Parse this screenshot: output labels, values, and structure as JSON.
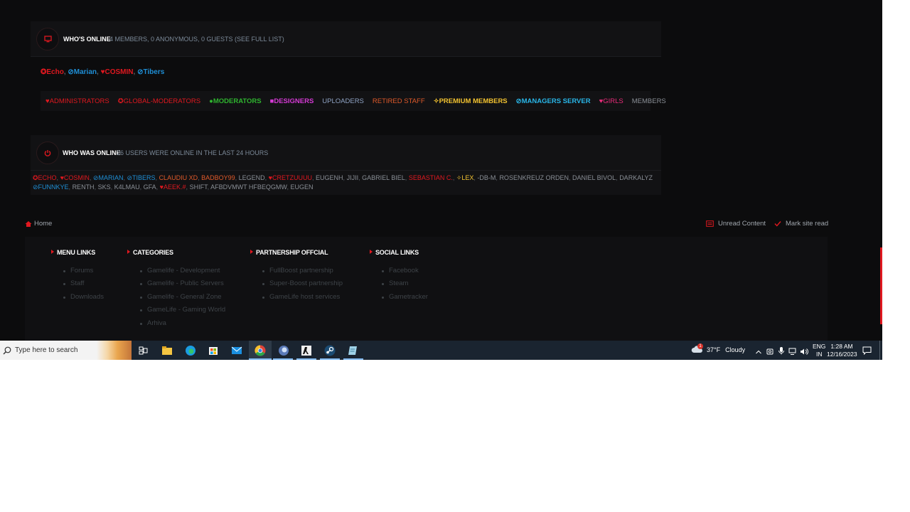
{
  "whos_online": {
    "title": "WHO'S ONLINE",
    "summary": "4 MEMBERS, 0 ANONYMOUS, 0 GUESTS (SEE FULL LIST)",
    "members": [
      {
        "name": "Echo",
        "color": "#e0181f",
        "prefix": "✪"
      },
      {
        "name": "Marian",
        "color": "#1f8fd6",
        "prefix": "⊘"
      },
      {
        "name": "COSMIN",
        "color": "#e0181f",
        "prefix": "♥"
      },
      {
        "name": "Tibers",
        "color": "#1f8fd6",
        "prefix": "⊘"
      }
    ],
    "groups": [
      {
        "label": "ADMINISTRATORS",
        "color": "#e0181f",
        "prefix": "♥"
      },
      {
        "label": "GLOBAL-MODERATORS",
        "color": "#e0181f",
        "prefix": "✪"
      },
      {
        "label": "MODERATORS",
        "color": "#2fb52f",
        "prefix": "●"
      },
      {
        "label": "DESIGNERS",
        "color": "#d43ad4",
        "prefix": "■"
      },
      {
        "label": "UPLOADERS",
        "color": "#8fa3c4",
        "prefix": ""
      },
      {
        "label": "RETIRED STAFF",
        "color": "#e05a2a",
        "prefix": ""
      },
      {
        "label": "PREMIUM MEMBERS",
        "color": "#f2c230",
        "prefix": "✧"
      },
      {
        "label": "MANAGERS SERVER",
        "color": "#29b6e8",
        "prefix": "⊘"
      },
      {
        "label": "GIRLS",
        "color": "#ea2c7a",
        "prefix": "♥"
      },
      {
        "label": "MEMBERS",
        "color": "#8a8f96",
        "prefix": ""
      }
    ]
  },
  "who_was_online": {
    "title": "WHO WAS ONLINE",
    "summary": "26 USERS WERE ONLINE IN THE LAST 24 HOURS",
    "line1": [
      {
        "name": "ECHO",
        "color": "#e0181f",
        "prefix": "✪"
      },
      {
        "name": "COSMIN",
        "color": "#e0181f",
        "prefix": "♥"
      },
      {
        "name": "MARIAN",
        "color": "#1f8fd6",
        "prefix": "⊘"
      },
      {
        "name": "TIBERS",
        "color": "#1f8fd6",
        "prefix": "⊘"
      },
      {
        "name": "CLAUDIU XD",
        "color": "#e05a2a",
        "prefix": ""
      },
      {
        "name": "BADBOY99",
        "color": "#e05a2a",
        "prefix": ""
      },
      {
        "name": "LEGEND",
        "color": "#8a8f96",
        "prefix": ""
      },
      {
        "name": "CRETZUUUU",
        "color": "#e0181f",
        "prefix": "♥"
      },
      {
        "name": "EUGENH",
        "color": "#8a8f96",
        "prefix": ""
      },
      {
        "name": "JIJII",
        "color": "#8a8f96",
        "prefix": ""
      },
      {
        "name": "GABRIEL BIEL",
        "color": "#8a8f96",
        "prefix": ""
      },
      {
        "name": "SEBASTIAN C.",
        "color": "#e0181f",
        "prefix": ""
      },
      {
        "name": "LEX",
        "color": "#f2c230",
        "prefix": "✧"
      },
      {
        "name": "-DB-M",
        "color": "#8a8f96",
        "prefix": ""
      },
      {
        "name": "ROSENKREUZ ORDEN",
        "color": "#8a8f96",
        "prefix": ""
      },
      {
        "name": "DANIEL BIVOL",
        "color": "#8a8f96",
        "prefix": ""
      },
      {
        "name": "DARKALYZ",
        "color": "#8a8f96",
        "prefix": ""
      }
    ],
    "line2": [
      {
        "name": "FUNNKYE",
        "color": "#1f8fd6",
        "prefix": "⊘"
      },
      {
        "name": "RENTH",
        "color": "#8a8f96",
        "prefix": ""
      },
      {
        "name": "SKS",
        "color": "#8a8f96",
        "prefix": ""
      },
      {
        "name": "K4LMAU",
        "color": "#8a8f96",
        "prefix": ""
      },
      {
        "name": "GFA",
        "color": "#8a8f96",
        "prefix": ""
      },
      {
        "name": "AEEK.#",
        "color": "#e0181f",
        "prefix": "♥"
      },
      {
        "name": "SHIFT",
        "color": "#8a8f96",
        "prefix": ""
      },
      {
        "name": "AFBDVMWT HFBEQGMW",
        "color": "#8a8f96",
        "prefix": ""
      },
      {
        "name": "EUGEN",
        "color": "#8a8f96",
        "prefix": ""
      }
    ]
  },
  "breadcrumb": {
    "home": "Home"
  },
  "actions": {
    "unread": "Unread Content",
    "mark_read": "Mark site read"
  },
  "footer": {
    "menu": {
      "title": "MENU LINKS",
      "items": [
        "Forums",
        "Staff",
        "Downloads"
      ]
    },
    "categories": {
      "title": "CATEGORIES",
      "items": [
        "Gamelife - Development",
        "Gamelife - Public Servers",
        "Gamelife - General Zone",
        "GameLife - Gaming World",
        "Arhiva"
      ]
    },
    "partners": {
      "title": "PARTNERSHIP OFFCIAL",
      "items": [
        "FullBoost partnership",
        "Super-Boost partnership",
        "GameLife host services"
      ]
    },
    "social": {
      "title": "SOCIAL LINKS",
      "items": [
        "Facebook",
        "Steam",
        "Gametracker"
      ]
    }
  },
  "taskbar": {
    "search_placeholder": "Type here to search",
    "weather_temp": "37°F",
    "weather_text": "Cloudy",
    "weather_badge": "1",
    "lang1": "ENG",
    "lang2": "IN",
    "time": "1:28 AM",
    "date": "12/16/2023"
  },
  "colors": {
    "accent": "#e0181f",
    "page_bg": "#0c0c0d",
    "panel_bg": "#121214"
  }
}
